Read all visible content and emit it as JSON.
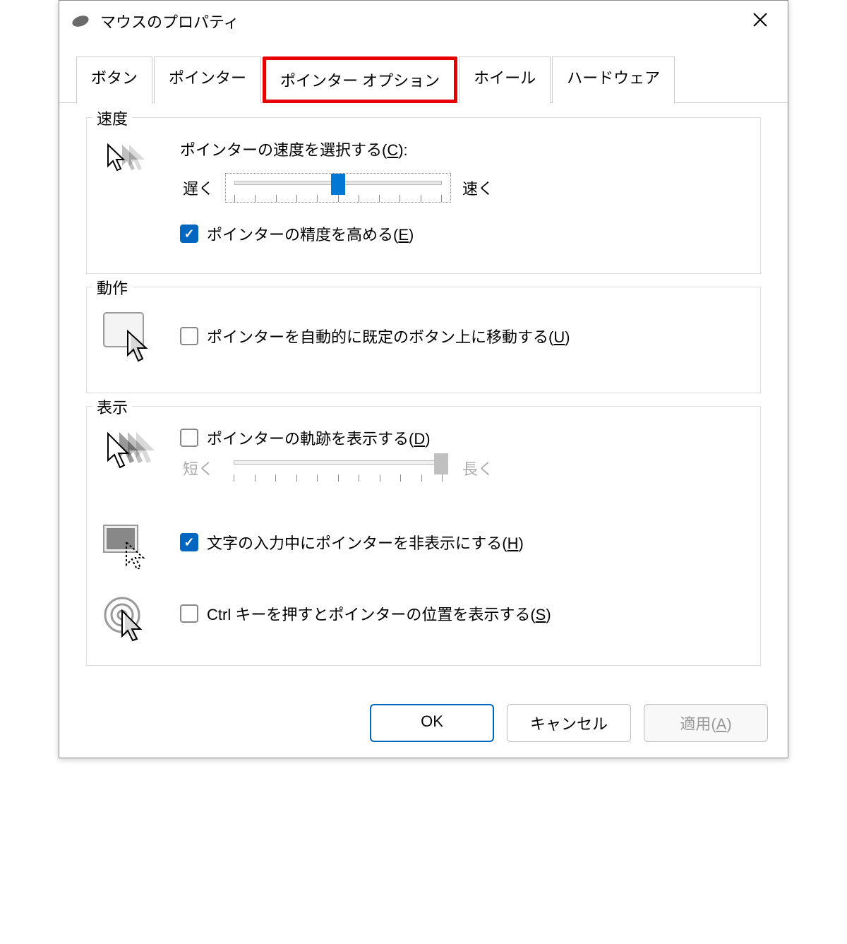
{
  "window": {
    "title": "マウスのプロパティ"
  },
  "tabs": {
    "items": [
      {
        "label": "ボタン"
      },
      {
        "label": "ポインター"
      },
      {
        "label": "ポインター オプション",
        "active": true,
        "highlighted": true
      },
      {
        "label": "ホイール"
      },
      {
        "label": "ハードウェア"
      }
    ]
  },
  "speed": {
    "title": "速度",
    "label_prefix": "ポインターの速度を選択する(",
    "label_key": "C",
    "label_suffix": "):",
    "slow": "遅く",
    "fast": "速く",
    "precision_prefix": "ポインターの精度を高める(",
    "precision_key": "E",
    "precision_suffix": ")",
    "precision_checked": true
  },
  "motion": {
    "title": "動作",
    "snap_prefix": "ポインターを自動的に既定のボタン上に移動する(",
    "snap_key": "U",
    "snap_suffix": ")",
    "snap_checked": false
  },
  "display": {
    "title": "表示",
    "trail_prefix": "ポインターの軌跡を表示する(",
    "trail_key": "D",
    "trail_suffix": ")",
    "trail_checked": false,
    "short": "短く",
    "long": "長く",
    "hide_prefix": "文字の入力中にポインターを非表示にする(",
    "hide_key": "H",
    "hide_suffix": ")",
    "hide_checked": true,
    "ctrl_prefix": "Ctrl キーを押すとポインターの位置を表示する(",
    "ctrl_key": "S",
    "ctrl_suffix": ")",
    "ctrl_checked": false
  },
  "buttons": {
    "ok": "OK",
    "cancel": "キャンセル",
    "apply_prefix": "適用(",
    "apply_key": "A",
    "apply_suffix": ")"
  }
}
